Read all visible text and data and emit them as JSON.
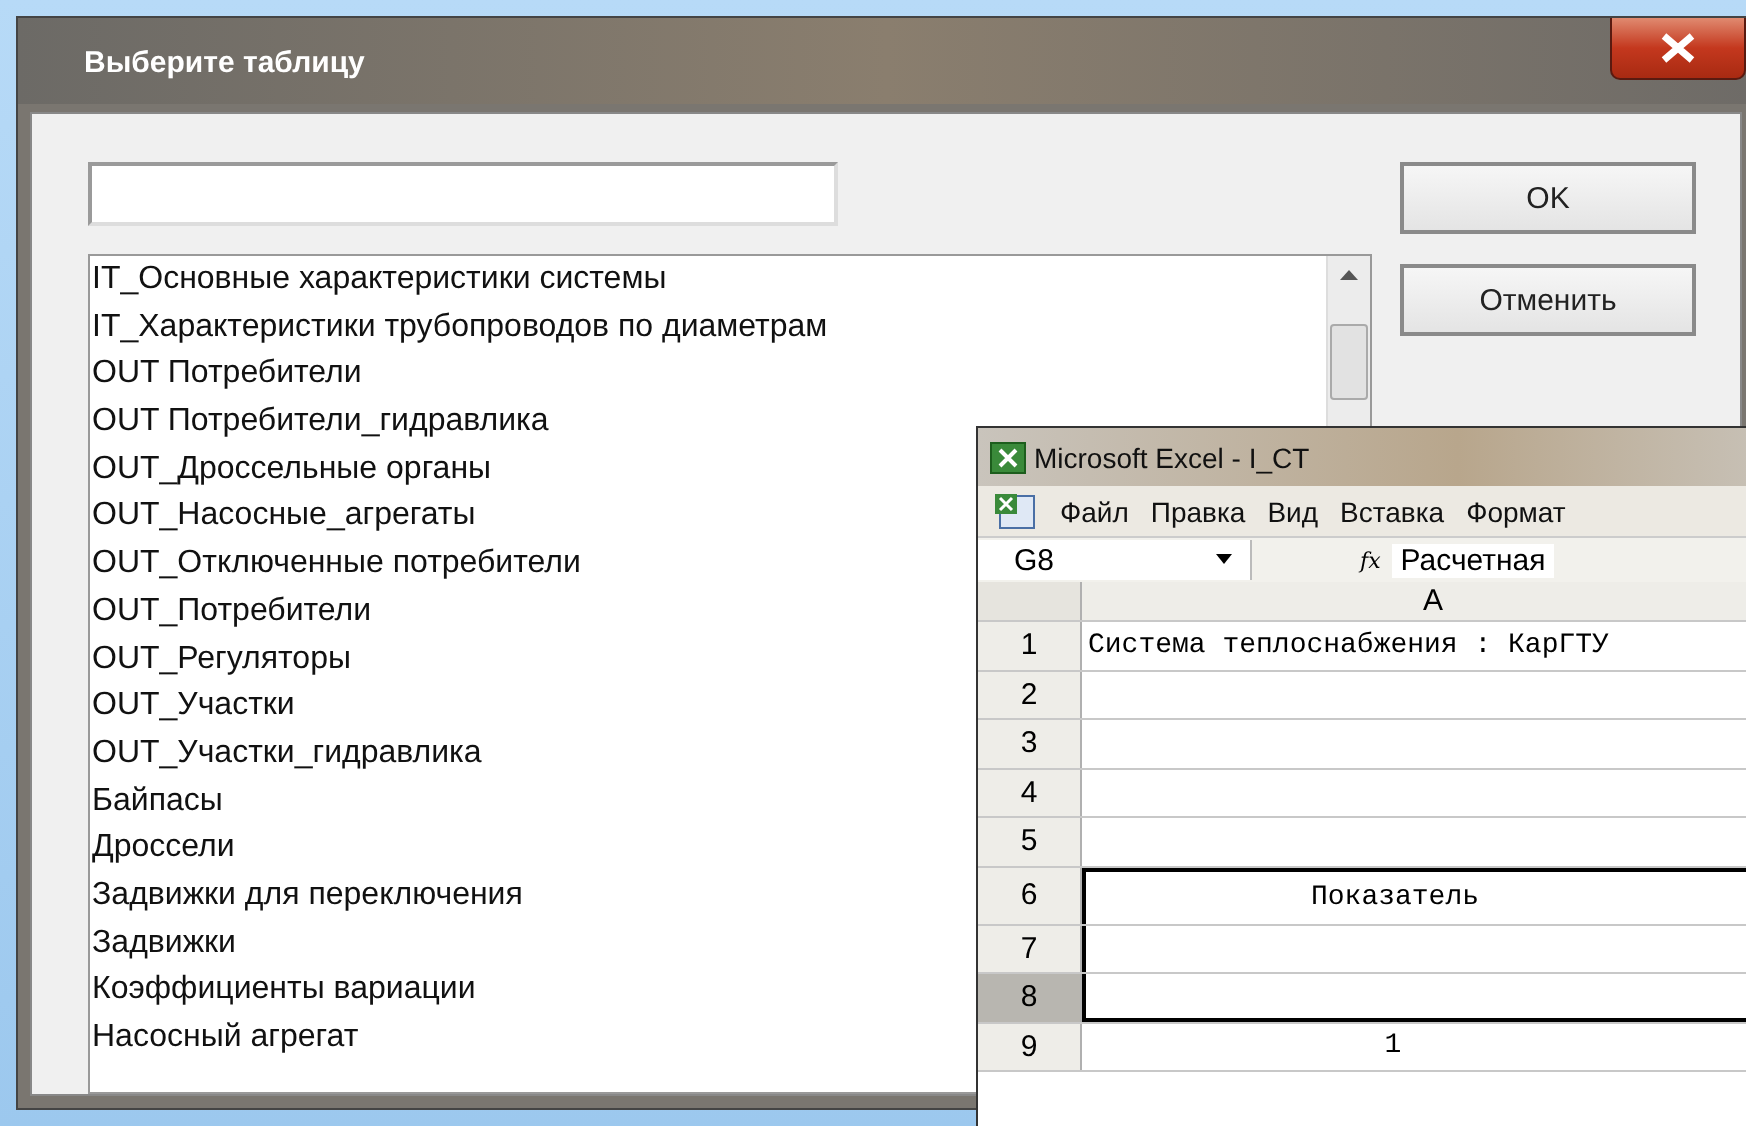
{
  "dialog": {
    "title": "Выберите таблицу",
    "list": [
      "IT_Основные характеристики системы",
      "IT_Характеристики трубопроводов по диаметрам",
      "OUT Потребители",
      "OUT Потребители_гидравлика",
      "OUT_Дроссельные органы",
      "OUT_Насосные_агрегаты",
      "OUT_Отключенные потребители",
      "OUT_Потребители",
      "OUT_Регуляторы",
      "OUT_Участки",
      "OUT_Участки_гидравлика",
      "Байпасы",
      "Дроссели",
      "Задвижки для переключения",
      "Задвижки",
      "Коэффициенты вариации",
      "Насосный агрегат"
    ],
    "buttons": [
      "OK",
      "Отменить"
    ]
  },
  "excel": {
    "title": "Microsoft Excel - I_CT",
    "menu": [
      "Файл",
      "Правка",
      "Вид",
      "Вставка",
      "Формат"
    ],
    "name_box": "G8",
    "function_label": "fx",
    "formula": "Расчетная",
    "column_header": "A",
    "rows": [
      {
        "number": "1",
        "text": "Система теплоснабжения : КарГТУ",
        "selected": false,
        "boxed": false
      },
      {
        "number": "2",
        "selected": false,
        "boxed": false
      },
      {
        "number": "3",
        "selected": false,
        "boxed": false
      },
      {
        "number": "4",
        "selected": false,
        "boxed": false
      },
      {
        "number": "5",
        "selected": false,
        "boxed": false
      },
      {
        "number": "6",
        "text": "Показатель",
        "selected": false,
        "boxed": true
      },
      {
        "number": "7",
        "selected": false,
        "boxed": true
      },
      {
        "number": "8",
        "selected": true,
        "boxed": true
      },
      {
        "number": "9",
        "text": "1",
        "selected": false,
        "boxed": false
      }
    ]
  }
}
